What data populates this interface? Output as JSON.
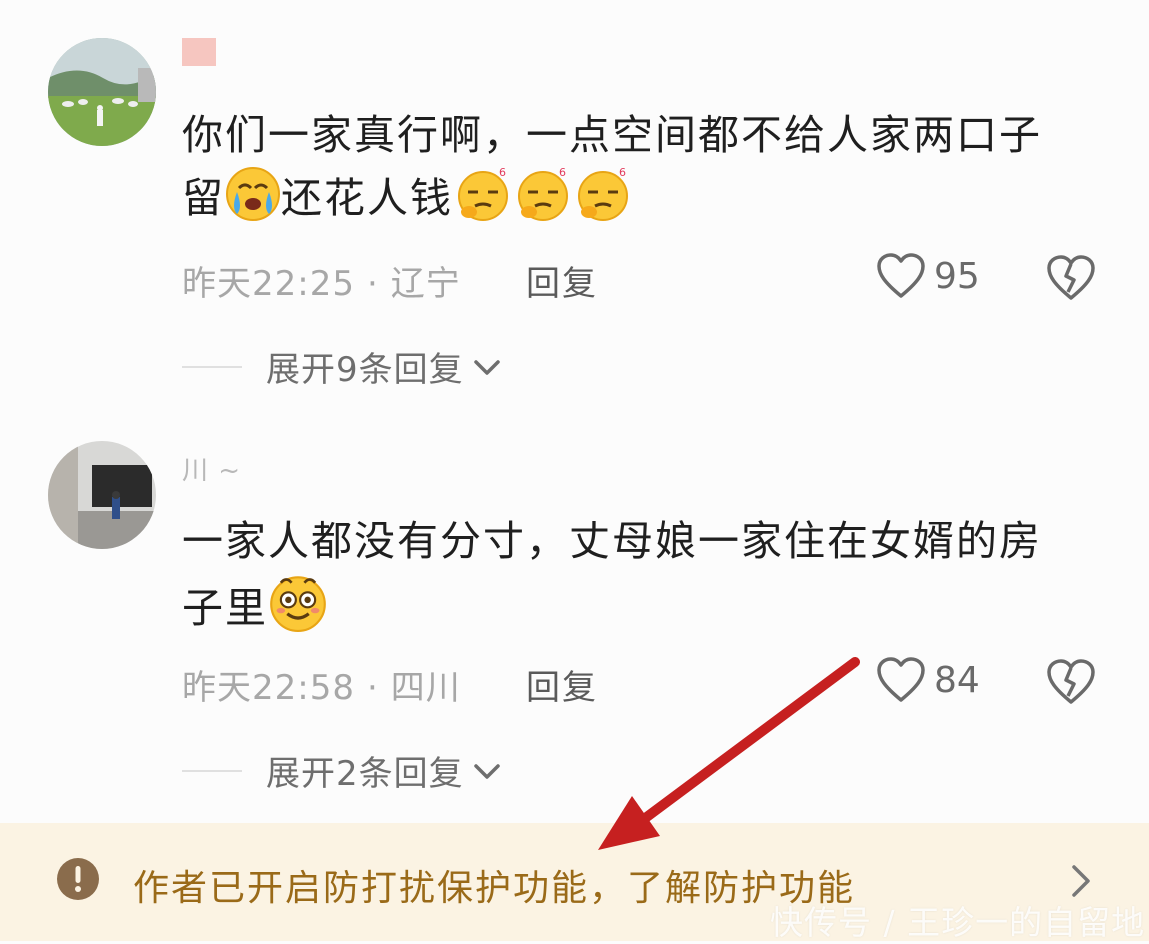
{
  "comments": [
    {
      "username": "",
      "text_line1": "你们一家真行啊，一点空间都不给人家两口子",
      "text_line2_start": "留",
      "text_line2_mid": "还花人钱",
      "time": "昨天22:25",
      "location": "辽宁",
      "reply_label": "回复",
      "like_count": "95",
      "expand_label": "展开9条回复"
    },
    {
      "username": "川 ~",
      "text_line1": "一家人都没有分寸，丈母娘一家住在女婿的房",
      "text_line2_start": "子里",
      "time": "昨天22:58",
      "location": "四川",
      "reply_label": "回复",
      "like_count": "84",
      "expand_label": "展开2条回复"
    }
  ],
  "notice": {
    "text": "作者已开启防打扰保护功能，了解防护功能"
  },
  "watermark": "快传号 / 王珍一的自留地",
  "colors": {
    "notice_bg": "#fbf3e3",
    "notice_text": "#9a6a18",
    "arrow": "#c62020"
  },
  "icons": [
    "heart-outline-icon",
    "broken-heart-icon",
    "chevron-down-icon",
    "exclamation-circle-icon",
    "chevron-right-icon",
    "crying-emoji",
    "eye-roll-emoji",
    "smiling-emoji"
  ]
}
